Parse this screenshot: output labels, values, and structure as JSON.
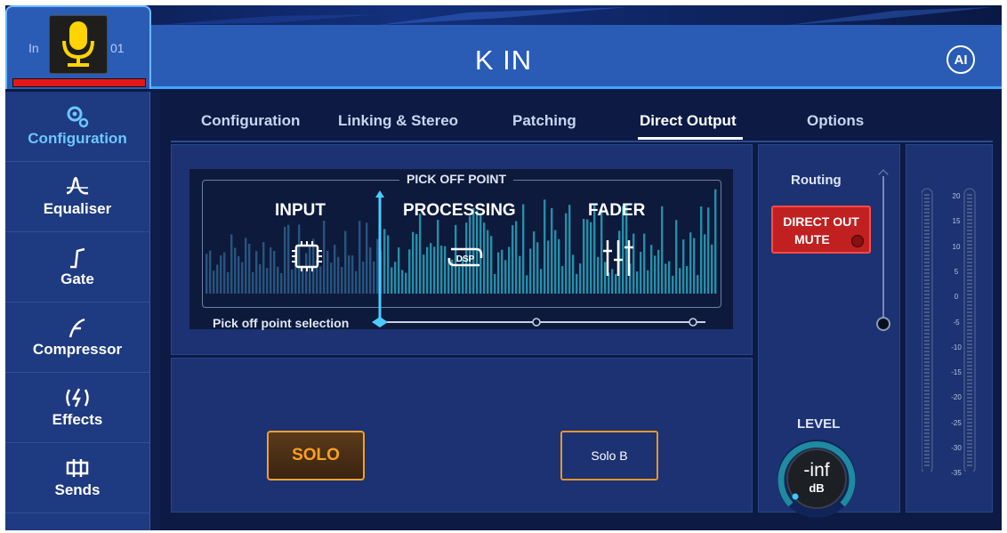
{
  "header": {
    "channel_prefix": "In",
    "channel_number": "01",
    "channel_icon": "microphone-icon",
    "channel_colour": "#e51818",
    "title": "K IN",
    "ai_label": "AI"
  },
  "sidebar": {
    "items": [
      {
        "label": "Configuration",
        "icon": "configuration-icon",
        "active": true
      },
      {
        "label": "Equaliser",
        "icon": "equaliser-icon",
        "active": false
      },
      {
        "label": "Gate",
        "icon": "gate-icon",
        "active": false
      },
      {
        "label": "Compressor",
        "icon": "compressor-icon",
        "active": false
      },
      {
        "label": "Effects",
        "icon": "effects-icon",
        "active": false
      },
      {
        "label": "Sends",
        "icon": "sends-icon",
        "active": false
      }
    ]
  },
  "tabs": [
    {
      "label": "Configuration"
    },
    {
      "label": "Linking & Stereo"
    },
    {
      "label": "Patching"
    },
    {
      "label": "Direct Output",
      "active": true
    },
    {
      "label": "Options"
    }
  ],
  "pickoff": {
    "title": "PICK OFF POINT",
    "stages": [
      "INPUT",
      "PROCESSING",
      "FADER"
    ],
    "stage_icons": [
      "chip-icon",
      "dsp-icon",
      "fader-icon"
    ],
    "dsp_text": "DSP",
    "selection_label": "Pick off point selection",
    "selected_index": 0
  },
  "solo": {
    "solo_label": "SOLO",
    "solo_b_label": "Solo B"
  },
  "routing": {
    "label": "Routing",
    "direct_out_line1": "DIRECT OUT",
    "direct_out_line2": "MUTE"
  },
  "level": {
    "label": "LEVEL",
    "value": "-inf",
    "unit": "dB"
  },
  "meter": {
    "scale": [
      "20",
      "15",
      "10",
      "5",
      "0",
      "-5",
      "-10",
      "-15",
      "-20",
      "-25",
      "-30",
      "-35"
    ]
  },
  "colors": {
    "accent": "#3fa6ff",
    "active_text": "#6cc7ff",
    "solo": "#f0a030",
    "mute": "#c02020"
  }
}
